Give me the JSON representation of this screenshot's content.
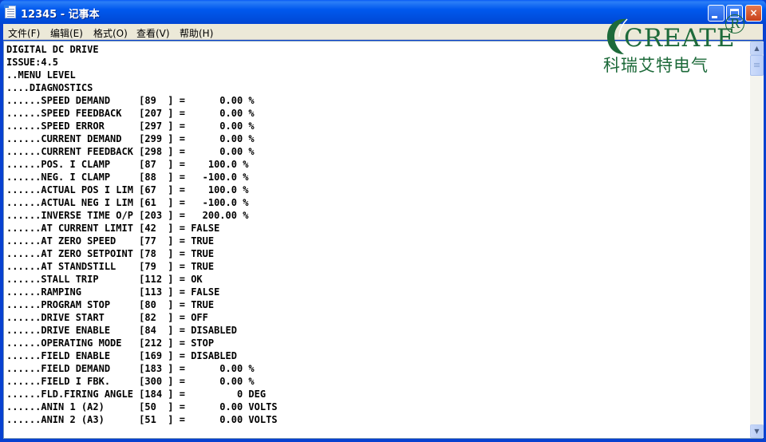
{
  "window": {
    "title": "12345 - 记事本",
    "controls": {
      "minimize": "minimize",
      "maximize": "maximize",
      "close": "×"
    }
  },
  "menu": [
    {
      "label": "文件(F)"
    },
    {
      "label": "编辑(E)"
    },
    {
      "label": "格式(O)"
    },
    {
      "label": "查看(V)"
    },
    {
      "label": "帮助(H)"
    }
  ],
  "logo": {
    "word": "CREATE",
    "registered": "R",
    "chinese": "科瑞艾特电气",
    "color": "#1d6a3a"
  },
  "document": {
    "lines": [
      "DIGITAL DC DRIVE",
      "ISSUE:4.5",
      "..MENU LEVEL",
      "....DIAGNOSTICS",
      "......SPEED DEMAND     [89  ] =      0.00 %",
      "......SPEED FEEDBACK   [207 ] =      0.00 %",
      "......SPEED ERROR      [297 ] =      0.00 %",
      "......CURRENT DEMAND   [299 ] =      0.00 %",
      "......CURRENT FEEDBACK [298 ] =      0.00 %",
      "......POS. I CLAMP     [87  ] =    100.0 %",
      "......NEG. I CLAMP     [88  ] =   -100.0 %",
      "......ACTUAL POS I LIM [67  ] =    100.0 %",
      "......ACTUAL NEG I LIM [61  ] =   -100.0 %",
      "......INVERSE TIME O/P [203 ] =   200.00 %",
      "......AT CURRENT LIMIT [42  ] = FALSE",
      "......AT ZERO SPEED    [77  ] = TRUE",
      "......AT ZERO SETPOINT [78  ] = TRUE",
      "......AT STANDSTILL    [79  ] = TRUE",
      "......STALL TRIP       [112 ] = OK",
      "......RAMPING          [113 ] = FALSE",
      "......PROGRAM STOP     [80  ] = TRUE",
      "......DRIVE START      [82  ] = OFF",
      "......DRIVE ENABLE     [84  ] = DISABLED",
      "......OPERATING MODE   [212 ] = STOP",
      "......FIELD ENABLE     [169 ] = DISABLED",
      "......FIELD DEMAND     [183 ] =      0.00 %",
      "......FIELD I FBK.     [300 ] =      0.00 %",
      "......FLD.FIRING ANGLE [184 ] =         0 DEG",
      "......ANIN 1 (A2)      [50  ] =      0.00 VOLTS",
      "......ANIN 2 (A3)      [51  ] =      0.00 VOLTS"
    ]
  },
  "scrollbar": {
    "up": "▲",
    "down": "▼"
  }
}
